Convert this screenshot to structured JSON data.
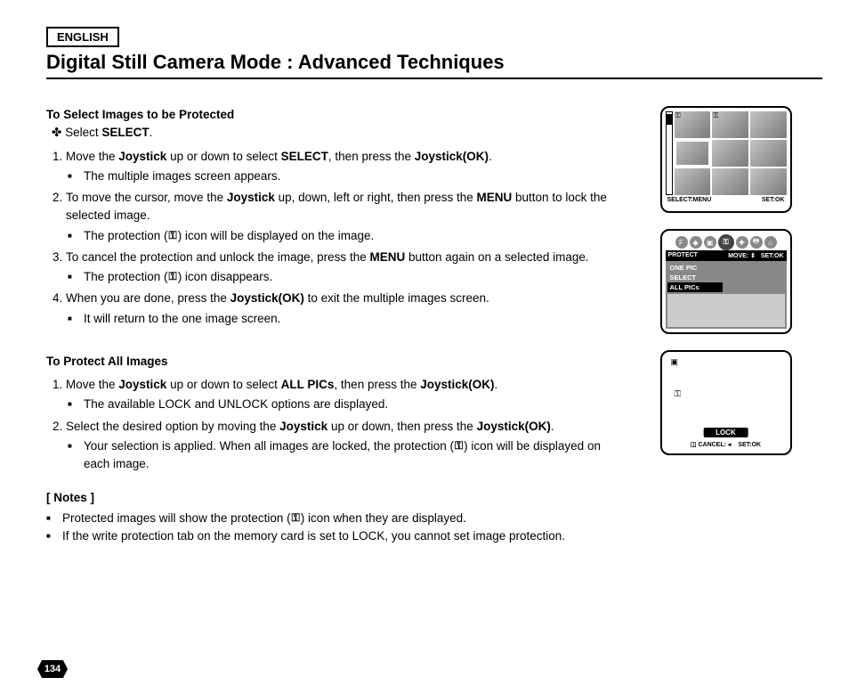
{
  "lang_label": "ENGLISH",
  "page_title": "Digital Still Camera Mode : Advanced Techniques",
  "page_number": "134",
  "section1": {
    "heading": "To Select Images to be Protected",
    "sub_prefix": "Select ",
    "sub_bold": "SELECT",
    "sub_suffix": ".",
    "s1a": "Move the ",
    "s1b": "Joystick",
    "s1c": " up or down to select ",
    "s1d": "SELECT",
    "s1e": ", then press the ",
    "s1f": "Joystick(OK)",
    "s1g": ".",
    "s1bul": "The multiple images screen appears.",
    "s2a": "To move the cursor, move the ",
    "s2b": "Joystick",
    "s2c": " up, down, left or right, then press the ",
    "s2d": "MENU",
    "s2e": " button to lock the selected image.",
    "s2bul_a": "The protection (",
    "s2bul_b": ") icon will be displayed on the image.",
    "s3a": "To cancel the protection and unlock the image, press the ",
    "s3b": "MENU",
    "s3c": " button again on a selected image.",
    "s3bul_a": "The protection (",
    "s3bul_b": ") icon disappears.",
    "s4a": "When you are done, press the ",
    "s4b": "Joystick(OK)",
    "s4c": " to exit the multiple images screen.",
    "s4bul": "It will return to the one image screen."
  },
  "section2": {
    "heading": "To Protect All Images",
    "s1a": "Move the ",
    "s1b": "Joystick",
    "s1c": " up or down to select ",
    "s1d": "ALL PICs",
    "s1e": ", then press the ",
    "s1f": "Joystick(OK)",
    "s1g": ".",
    "s1bul": "The available LOCK and UNLOCK options are displayed.",
    "s2a": "Select the desired option by moving the ",
    "s2b": "Joystick",
    "s2c": " up or down, then press the ",
    "s2d": "Joystick(OK)",
    "s2e": ".",
    "s2bul_a": "Your selection is applied. When all images are locked, the protection (",
    "s2bul_b": ") icon will be displayed on each image."
  },
  "notes": {
    "heading": "[ Notes ]",
    "n1a": "Protected images will show the protection (",
    "n1b": ") icon when they are displayed.",
    "n2": "If the write protection tab on the memory card is set to LOCK, you cannot set image protection."
  },
  "screen1": {
    "left": "SELECT:MENU",
    "right": "SET:OK"
  },
  "screen2": {
    "title": "PROTECT",
    "move": "MOVE:",
    "set": "SET:OK",
    "items": [
      "ONE PIC",
      "SELECT",
      "ALL PICs"
    ]
  },
  "screen3": {
    "lock": "LOCK",
    "cancel": "CANCEL:",
    "set": "SET:OK"
  },
  "key_glyph": "⚿"
}
